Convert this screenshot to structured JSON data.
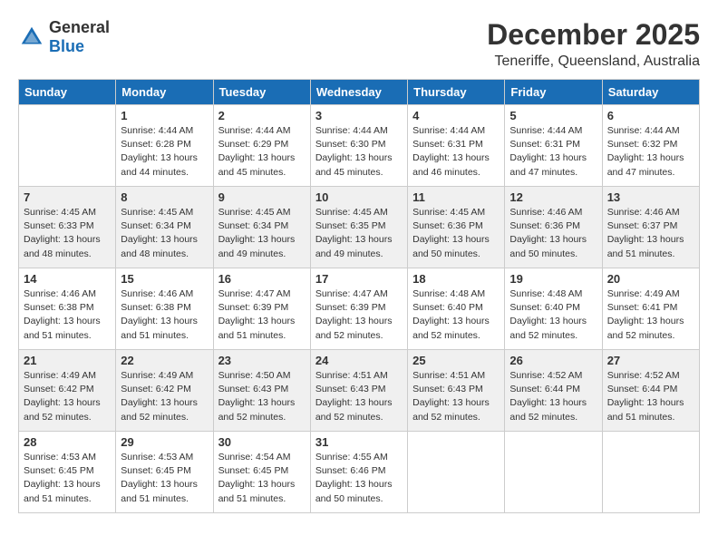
{
  "header": {
    "logo_general": "General",
    "logo_blue": "Blue",
    "month_year": "December 2025",
    "location": "Teneriffe, Queensland, Australia"
  },
  "days_of_week": [
    "Sunday",
    "Monday",
    "Tuesday",
    "Wednesday",
    "Thursday",
    "Friday",
    "Saturday"
  ],
  "weeks": [
    [
      {
        "day": "",
        "sunrise": "",
        "sunset": "",
        "daylight": ""
      },
      {
        "day": "1",
        "sunrise": "Sunrise: 4:44 AM",
        "sunset": "Sunset: 6:28 PM",
        "daylight": "Daylight: 13 hours and 44 minutes."
      },
      {
        "day": "2",
        "sunrise": "Sunrise: 4:44 AM",
        "sunset": "Sunset: 6:29 PM",
        "daylight": "Daylight: 13 hours and 45 minutes."
      },
      {
        "day": "3",
        "sunrise": "Sunrise: 4:44 AM",
        "sunset": "Sunset: 6:30 PM",
        "daylight": "Daylight: 13 hours and 45 minutes."
      },
      {
        "day": "4",
        "sunrise": "Sunrise: 4:44 AM",
        "sunset": "Sunset: 6:31 PM",
        "daylight": "Daylight: 13 hours and 46 minutes."
      },
      {
        "day": "5",
        "sunrise": "Sunrise: 4:44 AM",
        "sunset": "Sunset: 6:31 PM",
        "daylight": "Daylight: 13 hours and 47 minutes."
      },
      {
        "day": "6",
        "sunrise": "Sunrise: 4:44 AM",
        "sunset": "Sunset: 6:32 PM",
        "daylight": "Daylight: 13 hours and 47 minutes."
      }
    ],
    [
      {
        "day": "7",
        "sunrise": "Sunrise: 4:45 AM",
        "sunset": "Sunset: 6:33 PM",
        "daylight": "Daylight: 13 hours and 48 minutes."
      },
      {
        "day": "8",
        "sunrise": "Sunrise: 4:45 AM",
        "sunset": "Sunset: 6:34 PM",
        "daylight": "Daylight: 13 hours and 48 minutes."
      },
      {
        "day": "9",
        "sunrise": "Sunrise: 4:45 AM",
        "sunset": "Sunset: 6:34 PM",
        "daylight": "Daylight: 13 hours and 49 minutes."
      },
      {
        "day": "10",
        "sunrise": "Sunrise: 4:45 AM",
        "sunset": "Sunset: 6:35 PM",
        "daylight": "Daylight: 13 hours and 49 minutes."
      },
      {
        "day": "11",
        "sunrise": "Sunrise: 4:45 AM",
        "sunset": "Sunset: 6:36 PM",
        "daylight": "Daylight: 13 hours and 50 minutes."
      },
      {
        "day": "12",
        "sunrise": "Sunrise: 4:46 AM",
        "sunset": "Sunset: 6:36 PM",
        "daylight": "Daylight: 13 hours and 50 minutes."
      },
      {
        "day": "13",
        "sunrise": "Sunrise: 4:46 AM",
        "sunset": "Sunset: 6:37 PM",
        "daylight": "Daylight: 13 hours and 51 minutes."
      }
    ],
    [
      {
        "day": "14",
        "sunrise": "Sunrise: 4:46 AM",
        "sunset": "Sunset: 6:38 PM",
        "daylight": "Daylight: 13 hours and 51 minutes."
      },
      {
        "day": "15",
        "sunrise": "Sunrise: 4:46 AM",
        "sunset": "Sunset: 6:38 PM",
        "daylight": "Daylight: 13 hours and 51 minutes."
      },
      {
        "day": "16",
        "sunrise": "Sunrise: 4:47 AM",
        "sunset": "Sunset: 6:39 PM",
        "daylight": "Daylight: 13 hours and 51 minutes."
      },
      {
        "day": "17",
        "sunrise": "Sunrise: 4:47 AM",
        "sunset": "Sunset: 6:39 PM",
        "daylight": "Daylight: 13 hours and 52 minutes."
      },
      {
        "day": "18",
        "sunrise": "Sunrise: 4:48 AM",
        "sunset": "Sunset: 6:40 PM",
        "daylight": "Daylight: 13 hours and 52 minutes."
      },
      {
        "day": "19",
        "sunrise": "Sunrise: 4:48 AM",
        "sunset": "Sunset: 6:40 PM",
        "daylight": "Daylight: 13 hours and 52 minutes."
      },
      {
        "day": "20",
        "sunrise": "Sunrise: 4:49 AM",
        "sunset": "Sunset: 6:41 PM",
        "daylight": "Daylight: 13 hours and 52 minutes."
      }
    ],
    [
      {
        "day": "21",
        "sunrise": "Sunrise: 4:49 AM",
        "sunset": "Sunset: 6:42 PM",
        "daylight": "Daylight: 13 hours and 52 minutes."
      },
      {
        "day": "22",
        "sunrise": "Sunrise: 4:49 AM",
        "sunset": "Sunset: 6:42 PM",
        "daylight": "Daylight: 13 hours and 52 minutes."
      },
      {
        "day": "23",
        "sunrise": "Sunrise: 4:50 AM",
        "sunset": "Sunset: 6:43 PM",
        "daylight": "Daylight: 13 hours and 52 minutes."
      },
      {
        "day": "24",
        "sunrise": "Sunrise: 4:51 AM",
        "sunset": "Sunset: 6:43 PM",
        "daylight": "Daylight: 13 hours and 52 minutes."
      },
      {
        "day": "25",
        "sunrise": "Sunrise: 4:51 AM",
        "sunset": "Sunset: 6:43 PM",
        "daylight": "Daylight: 13 hours and 52 minutes."
      },
      {
        "day": "26",
        "sunrise": "Sunrise: 4:52 AM",
        "sunset": "Sunset: 6:44 PM",
        "daylight": "Daylight: 13 hours and 52 minutes."
      },
      {
        "day": "27",
        "sunrise": "Sunrise: 4:52 AM",
        "sunset": "Sunset: 6:44 PM",
        "daylight": "Daylight: 13 hours and 51 minutes."
      }
    ],
    [
      {
        "day": "28",
        "sunrise": "Sunrise: 4:53 AM",
        "sunset": "Sunset: 6:45 PM",
        "daylight": "Daylight: 13 hours and 51 minutes."
      },
      {
        "day": "29",
        "sunrise": "Sunrise: 4:53 AM",
        "sunset": "Sunset: 6:45 PM",
        "daylight": "Daylight: 13 hours and 51 minutes."
      },
      {
        "day": "30",
        "sunrise": "Sunrise: 4:54 AM",
        "sunset": "Sunset: 6:45 PM",
        "daylight": "Daylight: 13 hours and 51 minutes."
      },
      {
        "day": "31",
        "sunrise": "Sunrise: 4:55 AM",
        "sunset": "Sunset: 6:46 PM",
        "daylight": "Daylight: 13 hours and 50 minutes."
      },
      {
        "day": "",
        "sunrise": "",
        "sunset": "",
        "daylight": ""
      },
      {
        "day": "",
        "sunrise": "",
        "sunset": "",
        "daylight": ""
      },
      {
        "day": "",
        "sunrise": "",
        "sunset": "",
        "daylight": ""
      }
    ]
  ]
}
